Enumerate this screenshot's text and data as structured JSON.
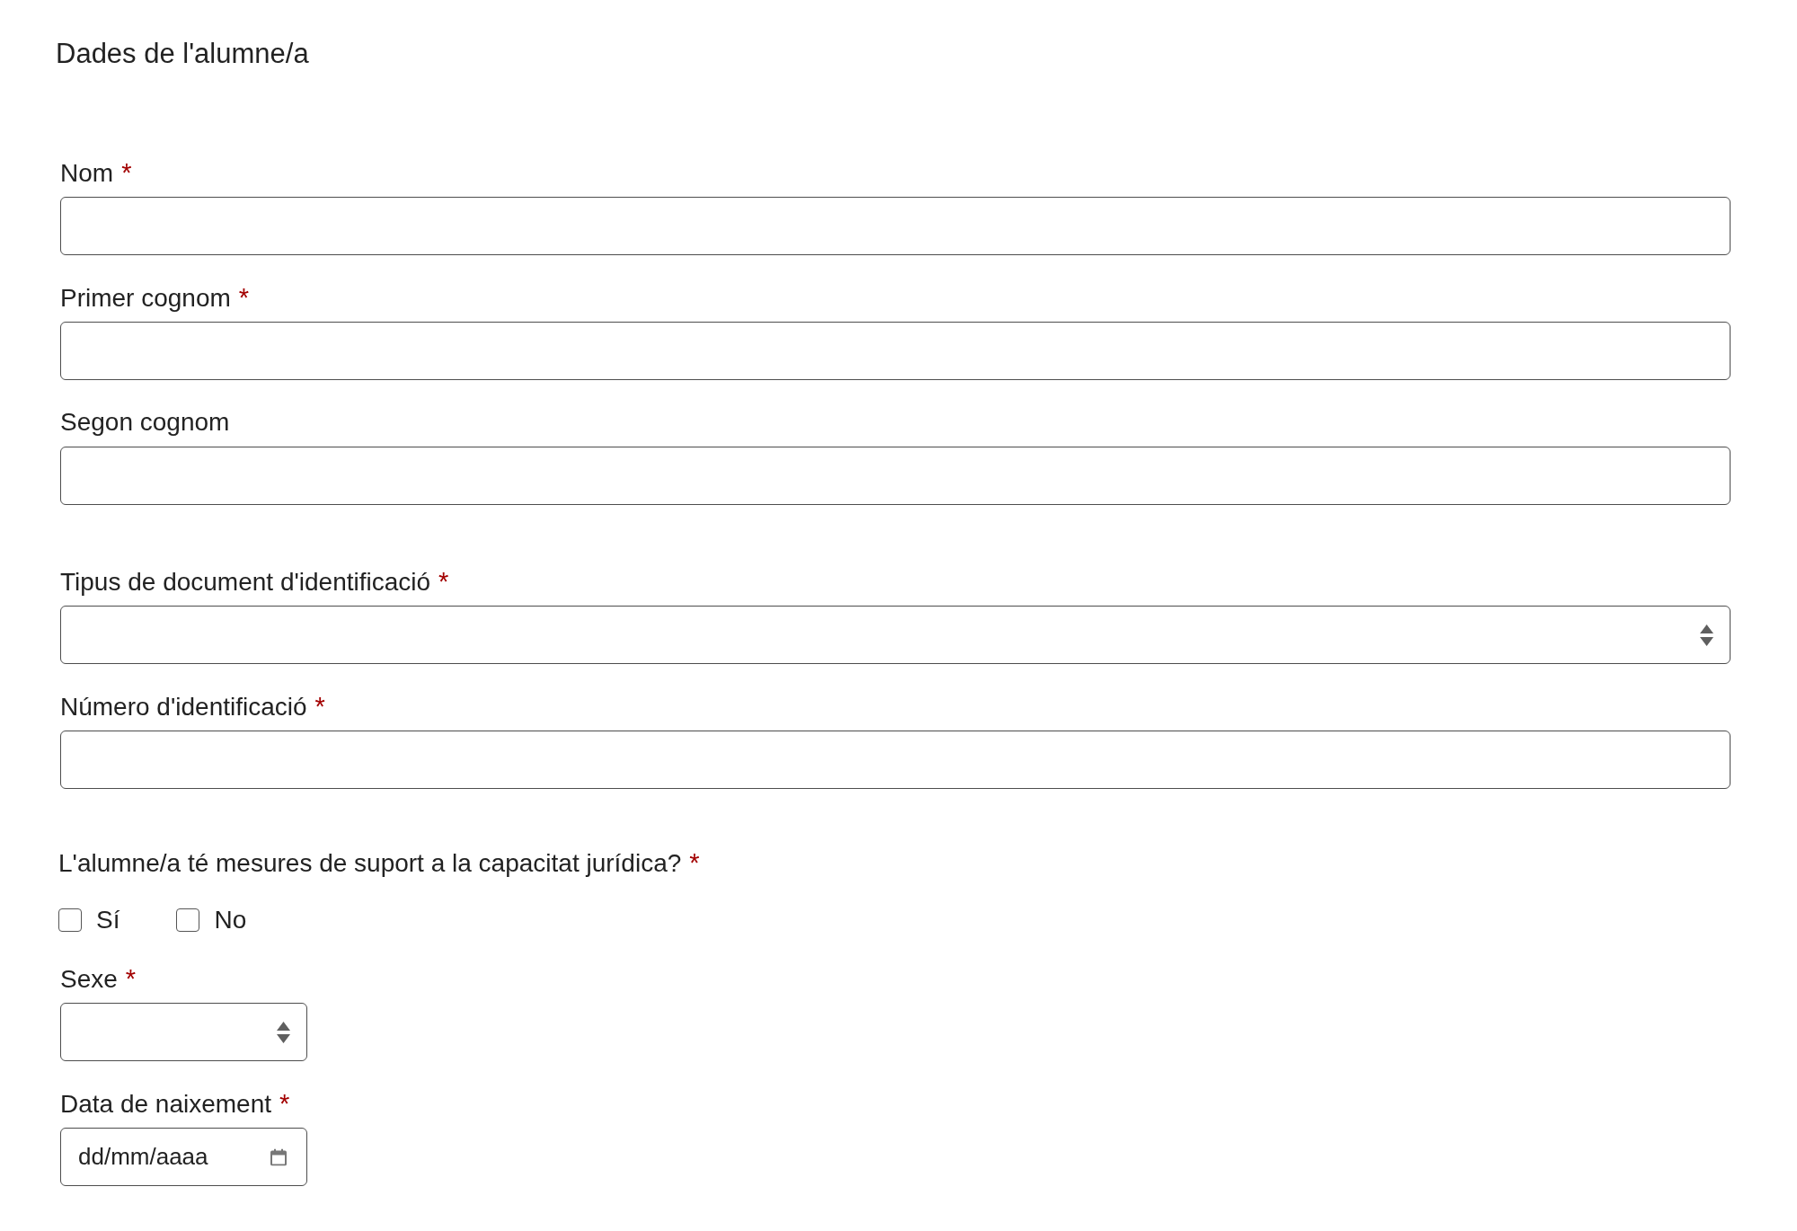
{
  "title": "Dades de l'alumne/a",
  "name_fields": [
    {
      "label": "Nom",
      "marker": "*"
    },
    {
      "label": "Primer cognom",
      "marker": "*"
    },
    {
      "label": "Segon cognom"
    }
  ],
  "identification_fields": [
    {
      "kind": "select",
      "label": "Tipus de document d'identificació",
      "marker": "*"
    },
    {
      "kind": "text",
      "label": "Número d'identificació",
      "marker": "*"
    }
  ],
  "legal_capacity_question": {
    "label": "L'alumne/a té mesures de suport a la capacitat jurídica?",
    "marker": "*",
    "options": [
      {
        "label": "Sí",
        "checked": false
      },
      {
        "label": "No",
        "checked": false
      }
    ]
  },
  "sex_field": {
    "label": "Sexe",
    "marker": "*"
  },
  "birth_date_field": {
    "label": "Data de naixement",
    "marker": "*",
    "placeholder": "dd/mm/aaaa"
  }
}
